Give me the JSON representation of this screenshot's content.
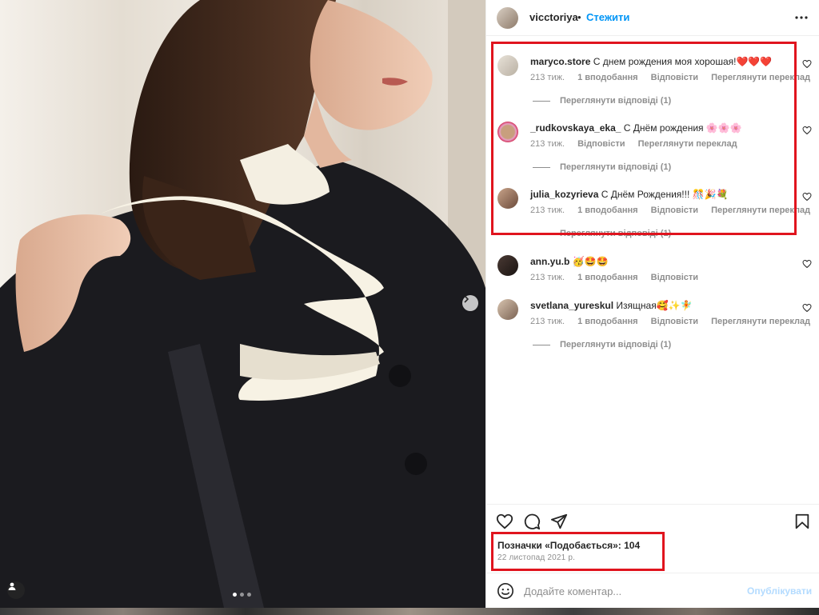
{
  "post": {
    "username": "vicctoriya",
    "separator": "•",
    "follow_label": "Стежити",
    "more_icon": "more-horizontal-icon",
    "carousel_dots": 3,
    "carousel_active": 1
  },
  "comments": [
    {
      "username": "maryco.store",
      "text": "С днем рождения моя хорошая!❤️❤️❤️",
      "time": "213 тиж.",
      "likes": "1 вподобання",
      "reply": "Відповісти",
      "translate": "Переглянути переклад",
      "view_replies": "Переглянути відповіді (1)"
    },
    {
      "username": "_rudkovskaya_eka_",
      "text": "С Днём рождения 🌸🌸🌸",
      "time": "213 тиж.",
      "likes": "",
      "reply": "Відповісти",
      "translate": "Переглянути переклад",
      "view_replies": "Переглянути відповіді (1)"
    },
    {
      "username": "julia_kozyrieva",
      "text": "С Днём Рождения!!! 🎊🎉💐",
      "time": "213 тиж.",
      "likes": "1 вподобання",
      "reply": "Відповісти",
      "translate": "Переглянути переклад",
      "view_replies": "Переглянути відповіді (1)"
    },
    {
      "username": "ann.yu.b",
      "text": "🥳🤩🤩",
      "time": "213 тиж.",
      "likes": "1 вподобання",
      "reply": "Відповісти",
      "translate": "",
      "view_replies": ""
    },
    {
      "username": "svetlana_yureskul",
      "text": "Изящная🥰✨🧚",
      "time": "213 тиж.",
      "likes": "1 вподобання",
      "reply": "Відповісти",
      "translate": "Переглянути переклад",
      "view_replies": "Переглянути відповіді (1)"
    }
  ],
  "actions": {
    "like_icon": "heart-icon",
    "comment_icon": "comment-bubble-icon",
    "share_icon": "paper-plane-icon",
    "save_icon": "bookmark-icon"
  },
  "likes_text": "Позначки «Подобається»: 104",
  "date_text": "22 листопад 2021 р.",
  "add_comment": {
    "placeholder": "Додайте коментар...",
    "publish_label": "Опублікувати",
    "emoji_icon": "smiley-icon"
  },
  "colors": {
    "accent": "#0095f6",
    "publish_disabled": "#b3dbff",
    "highlight": "#e0141e",
    "text": "#262626",
    "muted": "#8e8e8e"
  }
}
